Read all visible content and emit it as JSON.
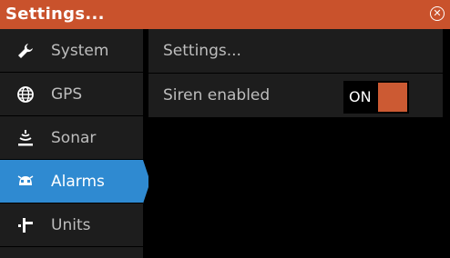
{
  "window": {
    "title": "Settings...",
    "close_icon": "close-icon"
  },
  "sidebar": {
    "items": [
      {
        "label": "System",
        "icon": "wrench-icon"
      },
      {
        "label": "GPS",
        "icon": "globe-icon"
      },
      {
        "label": "Sonar",
        "icon": "sonar-icon"
      },
      {
        "label": "Alarms",
        "icon": "alarm-icon",
        "selected": true
      },
      {
        "label": "Units",
        "icon": "units-icon"
      }
    ]
  },
  "content": {
    "settings_row": {
      "label": "Settings..."
    },
    "siren_row": {
      "label": "Siren enabled",
      "toggle_text": "ON",
      "toggle_state": "on"
    }
  },
  "colors": {
    "titlebar": "#c9522c",
    "accent_selected": "#2f8ad1",
    "toggle_on": "#cc5a33",
    "panel": "#1d1d1d",
    "background": "#000000"
  }
}
